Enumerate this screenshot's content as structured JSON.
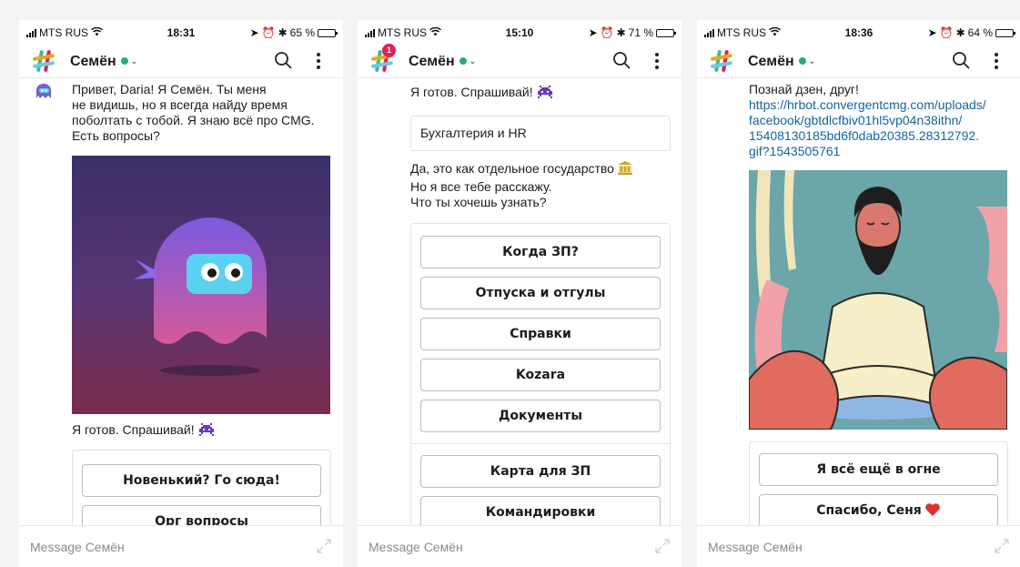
{
  "colors": {
    "accent_link": "#1264a3",
    "presence": "#2bac76",
    "badge": "#e01e5a"
  },
  "phones": [
    {
      "status": {
        "carrier": "MTS RUS",
        "time": "18:31",
        "battery": "65 %",
        "battery_level": 0.65
      },
      "header": {
        "title": "Семён"
      },
      "input_placeholder": "Message Семён",
      "message_text": "Привет, Daria! Я Семён. Ты меня\nне видишь, но я всегда найду время\nпоболтать с тобой. Я знаю всё про CMG.\nЕсть вопросы?",
      "ready_text": "Я готов. Спрашивай!",
      "buttons": [
        "Новенький? Го сюда!",
        "Орг вопросы"
      ]
    },
    {
      "status": {
        "carrier": "MTS RUS",
        "time": "15:10",
        "battery": "71 %",
        "battery_level": 0.71
      },
      "header": {
        "title": "Семён",
        "badge": "1"
      },
      "input_placeholder": "Message Семён",
      "ready_text": "Я готов. Спрашивай!",
      "user_choice": "Бухгалтерия и HR",
      "reply_line1": "Да, это как отдельное государство",
      "reply_rest": "Но я все тебе расскажу.\nЧто ты хочешь узнать?",
      "buttons": [
        "Когда ЗП?",
        "Отпуска и отгулы",
        "Справки",
        "Kozara",
        "Документы",
        "Карта для ЗП",
        "Командировки"
      ]
    },
    {
      "status": {
        "carrier": "MTS RUS",
        "time": "18:36",
        "battery": "64 %",
        "battery_level": 0.64
      },
      "header": {
        "title": "Семён"
      },
      "input_placeholder": "Message Семён",
      "zen_text": "Познай дзен, друг!",
      "link": "https://hrbot.convergentcmg.com/uploads/\nfacebook/gbtdlcfbiv01hl5vp04n38ithn/\n15408130185bd6f0dab20385.28312792.\ngif?1543505761",
      "buttons": [
        "Я всё ещё в огне",
        "Спасибо, Сеня"
      ]
    }
  ]
}
